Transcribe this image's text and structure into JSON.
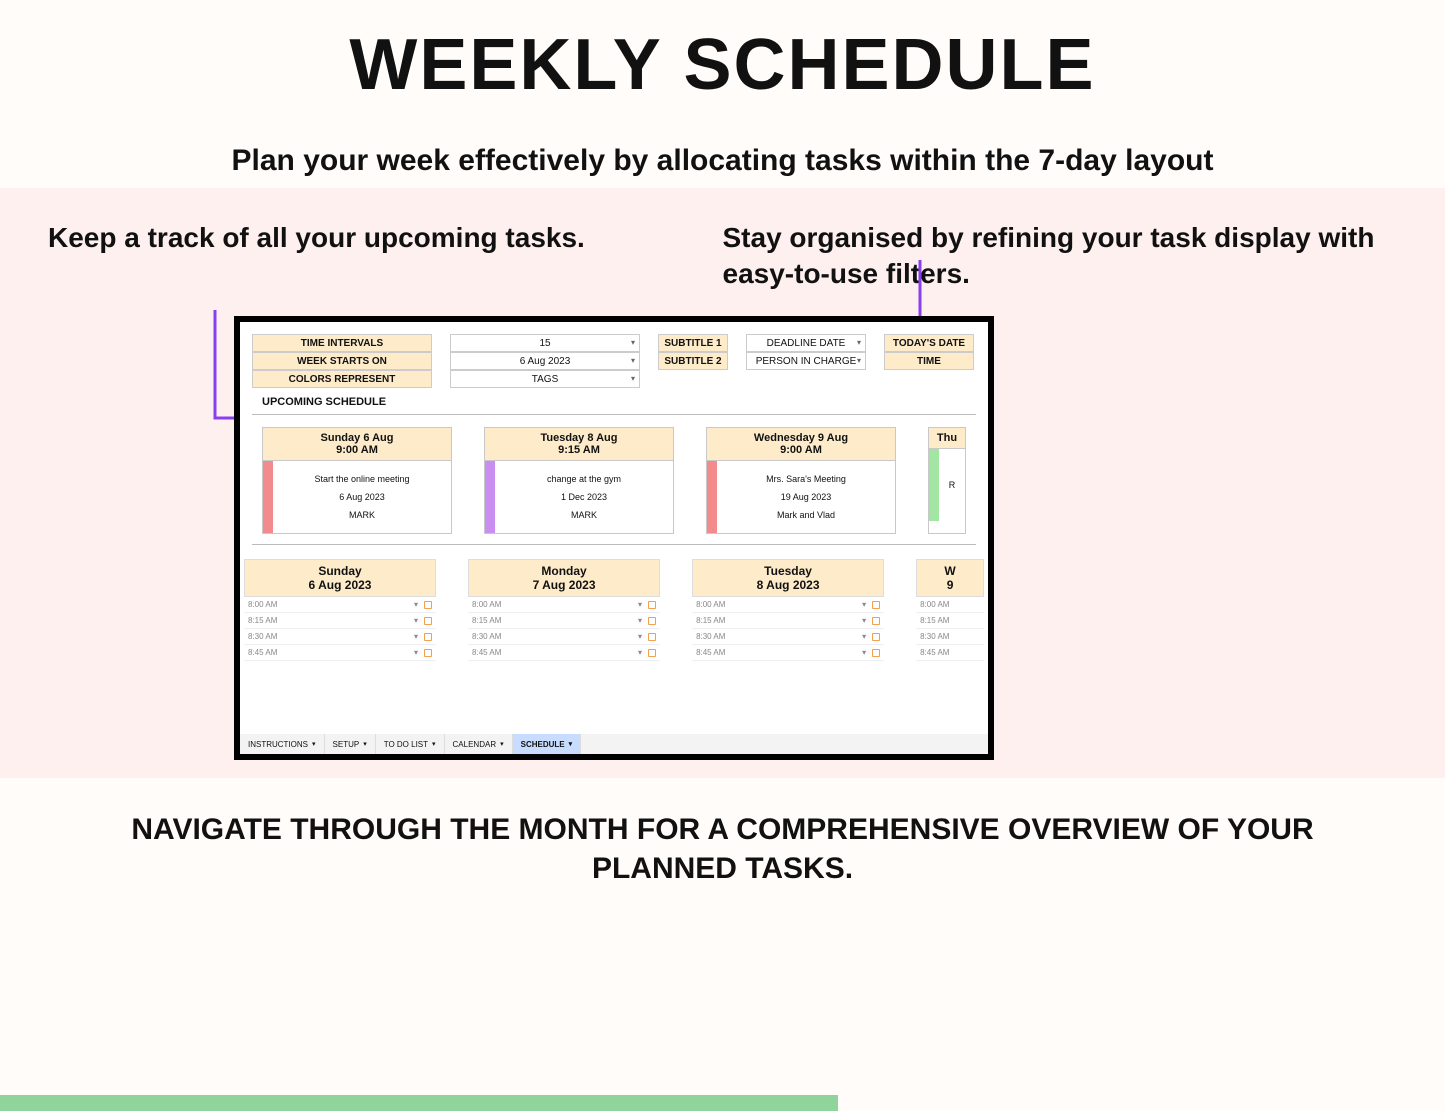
{
  "header": {
    "title": "WEEKLY SCHEDULE",
    "subtitle": "Plan your week effectively by allocating tasks within the 7-day layout"
  },
  "callouts": {
    "left": "Keep a track of all your upcoming tasks.",
    "right": "Stay organised by refining your task display with easy-to-use filters."
  },
  "config": {
    "labels": {
      "time_intervals": "TIME INTERVALS",
      "week_starts_on": "WEEK STARTS ON",
      "colors_represent": "COLORS REPRESENT",
      "subtitle1": "SUBTITLE 1",
      "subtitle2": "SUBTITLE 2",
      "todays_date": "TODAY'S DATE",
      "time": "TIME"
    },
    "values": {
      "time_intervals": "15",
      "week_starts_on": "6 Aug 2023",
      "colors_represent": "TAGS",
      "subtitle1": "DEADLINE DATE",
      "subtitle2": "PERSON IN CHARGE"
    }
  },
  "upcoming": {
    "section_label": "UPCOMING SCHEDULE",
    "cards": [
      {
        "day": "Sunday 6 Aug",
        "time": "9:00 AM",
        "task": "Start the online meeting",
        "date": "6 Aug 2023",
        "person": "MARK",
        "color": "red"
      },
      {
        "day": "Tuesday 8 Aug",
        "time": "9:15 AM",
        "task": "change at the gym",
        "date": "1 Dec 2023",
        "person": "MARK",
        "color": "purple"
      },
      {
        "day": "Wednesday 9 Aug",
        "time": "9:00 AM",
        "task": "Mrs. Sara's Meeting",
        "date": "19 Aug 2023",
        "person": "Mark and Vlad",
        "color": "red"
      },
      {
        "day": "Thu",
        "time": "",
        "task": "R",
        "date": "",
        "person": "",
        "color": "green"
      }
    ]
  },
  "day_grid": {
    "columns": [
      {
        "dow": "Sunday",
        "date": "6 Aug 2023"
      },
      {
        "dow": "Monday",
        "date": "7 Aug 2023"
      },
      {
        "dow": "Tuesday",
        "date": "8 Aug 2023"
      },
      {
        "dow": "W",
        "date": "9"
      }
    ],
    "slots": [
      "8:00 AM",
      "8:15 AM",
      "8:30 AM",
      "8:45 AM"
    ]
  },
  "tabs": [
    {
      "label": "INSTRUCTIONS",
      "active": false
    },
    {
      "label": "SETUP",
      "active": false
    },
    {
      "label": "TO DO LIST",
      "active": false
    },
    {
      "label": "CALENDAR",
      "active": false
    },
    {
      "label": "SCHEDULE",
      "active": true
    }
  ],
  "footer": "NAVIGATE THROUGH THE MONTH FOR A COMPREHENSIVE OVERVIEW OF YOUR PLANNED TASKS.",
  "colors": {
    "accent_purple": "#8a3ef2"
  }
}
